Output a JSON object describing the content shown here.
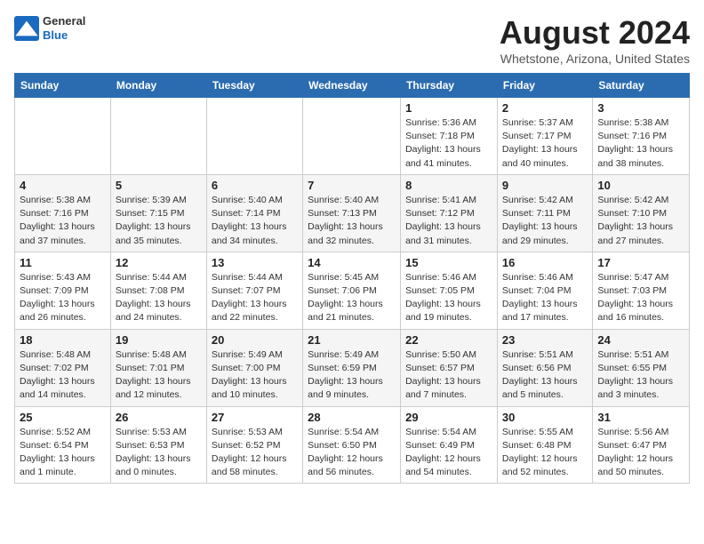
{
  "header": {
    "logo_general": "General",
    "logo_blue": "Blue",
    "month_year": "August 2024",
    "location": "Whetstone, Arizona, United States"
  },
  "days_of_week": [
    "Sunday",
    "Monday",
    "Tuesday",
    "Wednesday",
    "Thursday",
    "Friday",
    "Saturday"
  ],
  "weeks": [
    [
      {
        "day": "",
        "info": ""
      },
      {
        "day": "",
        "info": ""
      },
      {
        "day": "",
        "info": ""
      },
      {
        "day": "",
        "info": ""
      },
      {
        "day": "1",
        "info": "Sunrise: 5:36 AM\nSunset: 7:18 PM\nDaylight: 13 hours\nand 41 minutes."
      },
      {
        "day": "2",
        "info": "Sunrise: 5:37 AM\nSunset: 7:17 PM\nDaylight: 13 hours\nand 40 minutes."
      },
      {
        "day": "3",
        "info": "Sunrise: 5:38 AM\nSunset: 7:16 PM\nDaylight: 13 hours\nand 38 minutes."
      }
    ],
    [
      {
        "day": "4",
        "info": "Sunrise: 5:38 AM\nSunset: 7:16 PM\nDaylight: 13 hours\nand 37 minutes."
      },
      {
        "day": "5",
        "info": "Sunrise: 5:39 AM\nSunset: 7:15 PM\nDaylight: 13 hours\nand 35 minutes."
      },
      {
        "day": "6",
        "info": "Sunrise: 5:40 AM\nSunset: 7:14 PM\nDaylight: 13 hours\nand 34 minutes."
      },
      {
        "day": "7",
        "info": "Sunrise: 5:40 AM\nSunset: 7:13 PM\nDaylight: 13 hours\nand 32 minutes."
      },
      {
        "day": "8",
        "info": "Sunrise: 5:41 AM\nSunset: 7:12 PM\nDaylight: 13 hours\nand 31 minutes."
      },
      {
        "day": "9",
        "info": "Sunrise: 5:42 AM\nSunset: 7:11 PM\nDaylight: 13 hours\nand 29 minutes."
      },
      {
        "day": "10",
        "info": "Sunrise: 5:42 AM\nSunset: 7:10 PM\nDaylight: 13 hours\nand 27 minutes."
      }
    ],
    [
      {
        "day": "11",
        "info": "Sunrise: 5:43 AM\nSunset: 7:09 PM\nDaylight: 13 hours\nand 26 minutes."
      },
      {
        "day": "12",
        "info": "Sunrise: 5:44 AM\nSunset: 7:08 PM\nDaylight: 13 hours\nand 24 minutes."
      },
      {
        "day": "13",
        "info": "Sunrise: 5:44 AM\nSunset: 7:07 PM\nDaylight: 13 hours\nand 22 minutes."
      },
      {
        "day": "14",
        "info": "Sunrise: 5:45 AM\nSunset: 7:06 PM\nDaylight: 13 hours\nand 21 minutes."
      },
      {
        "day": "15",
        "info": "Sunrise: 5:46 AM\nSunset: 7:05 PM\nDaylight: 13 hours\nand 19 minutes."
      },
      {
        "day": "16",
        "info": "Sunrise: 5:46 AM\nSunset: 7:04 PM\nDaylight: 13 hours\nand 17 minutes."
      },
      {
        "day": "17",
        "info": "Sunrise: 5:47 AM\nSunset: 7:03 PM\nDaylight: 13 hours\nand 16 minutes."
      }
    ],
    [
      {
        "day": "18",
        "info": "Sunrise: 5:48 AM\nSunset: 7:02 PM\nDaylight: 13 hours\nand 14 minutes."
      },
      {
        "day": "19",
        "info": "Sunrise: 5:48 AM\nSunset: 7:01 PM\nDaylight: 13 hours\nand 12 minutes."
      },
      {
        "day": "20",
        "info": "Sunrise: 5:49 AM\nSunset: 7:00 PM\nDaylight: 13 hours\nand 10 minutes."
      },
      {
        "day": "21",
        "info": "Sunrise: 5:49 AM\nSunset: 6:59 PM\nDaylight: 13 hours\nand 9 minutes."
      },
      {
        "day": "22",
        "info": "Sunrise: 5:50 AM\nSunset: 6:57 PM\nDaylight: 13 hours\nand 7 minutes."
      },
      {
        "day": "23",
        "info": "Sunrise: 5:51 AM\nSunset: 6:56 PM\nDaylight: 13 hours\nand 5 minutes."
      },
      {
        "day": "24",
        "info": "Sunrise: 5:51 AM\nSunset: 6:55 PM\nDaylight: 13 hours\nand 3 minutes."
      }
    ],
    [
      {
        "day": "25",
        "info": "Sunrise: 5:52 AM\nSunset: 6:54 PM\nDaylight: 13 hours\nand 1 minute."
      },
      {
        "day": "26",
        "info": "Sunrise: 5:53 AM\nSunset: 6:53 PM\nDaylight: 13 hours\nand 0 minutes."
      },
      {
        "day": "27",
        "info": "Sunrise: 5:53 AM\nSunset: 6:52 PM\nDaylight: 12 hours\nand 58 minutes."
      },
      {
        "day": "28",
        "info": "Sunrise: 5:54 AM\nSunset: 6:50 PM\nDaylight: 12 hours\nand 56 minutes."
      },
      {
        "day": "29",
        "info": "Sunrise: 5:54 AM\nSunset: 6:49 PM\nDaylight: 12 hours\nand 54 minutes."
      },
      {
        "day": "30",
        "info": "Sunrise: 5:55 AM\nSunset: 6:48 PM\nDaylight: 12 hours\nand 52 minutes."
      },
      {
        "day": "31",
        "info": "Sunrise: 5:56 AM\nSunset: 6:47 PM\nDaylight: 12 hours\nand 50 minutes."
      }
    ]
  ]
}
